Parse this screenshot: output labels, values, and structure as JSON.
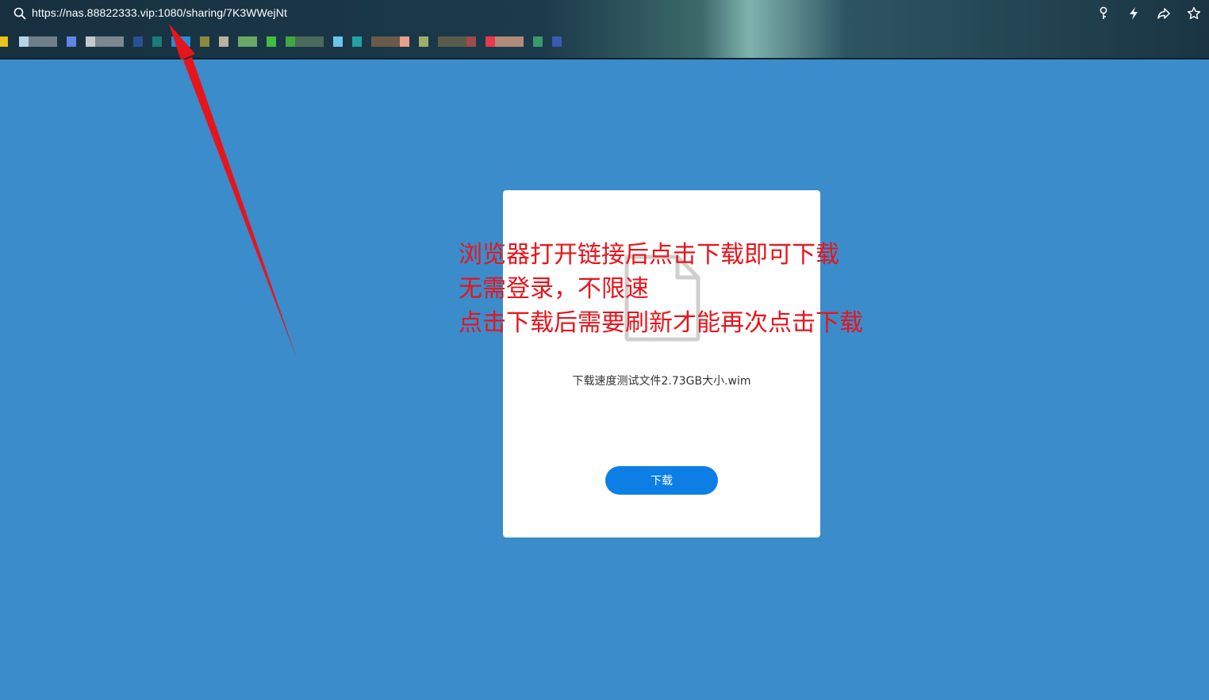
{
  "browser": {
    "url": "https://nas.88822333.vip:1080/sharing/7K3WWejNt",
    "icons": [
      "key-icon",
      "bolt-icon",
      "share-icon",
      "star-icon"
    ]
  },
  "file": {
    "name": "下载速度测试文件2.73GB大小.wim"
  },
  "download_button": {
    "label": "下载",
    "color": "#0d7ee6"
  },
  "annotation": {
    "line1": "浏览器打开链接后点击下载即可下载",
    "line2": "无需登录，不限速",
    "line3": "点击下载后需要刷新才能再次点击下载",
    "color": "#e8141b"
  },
  "colors": {
    "page_background": "#3a8ccb",
    "card_background": "#ffffff"
  }
}
